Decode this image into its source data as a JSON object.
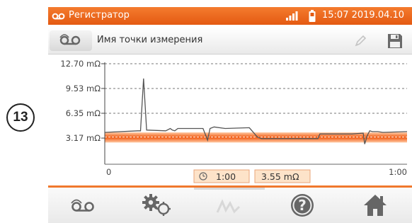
{
  "callout": {
    "number": "13"
  },
  "status_bar": {
    "title": "Регистратор",
    "time": "15:07",
    "date": "2019.04.10",
    "signal_icon": "signal-bars-icon",
    "battery_icon": "battery-icon",
    "app_icon": "recorder-icon"
  },
  "name_bar": {
    "label": "Имя точки измерения",
    "icons": [
      "recorder-icon",
      "pencil-icon",
      "save-icon"
    ]
  },
  "chart_data": {
    "type": "line",
    "y_ticks": [
      "12.70 mΩ",
      "9.53 mΩ",
      "6.35 mΩ",
      "3.17 mΩ"
    ],
    "y_tick_values": [
      12.7,
      9.53,
      6.35,
      3.17
    ],
    "ylim": [
      0,
      12.7
    ],
    "x_ticks": [
      "0",
      "1:00"
    ],
    "xlim": [
      0,
      60
    ],
    "grid": "dashed horizontal",
    "band": {
      "center": 3.3,
      "low": 2.6,
      "high": 3.9,
      "color": "#f47b2e"
    },
    "series": [
      {
        "color": "#555555",
        "x": [
          0,
          6.5,
          7.1,
          7.7,
          8.3,
          12.1,
          13.0,
          13.4,
          13.9,
          14.5,
          19.5,
          20.4,
          20.9,
          21.7,
          23.9,
          28.7,
          30.3,
          31.1,
          37.6,
          42.3,
          42.7,
          47.3,
          49.1,
          51.3,
          51.6,
          52.1,
          52.6,
          53.1,
          54.2,
          55.2,
          60
        ],
        "y": [
          3.9,
          4.1,
          4.1,
          10.8,
          4.2,
          4.1,
          4.4,
          4.2,
          4.1,
          4.4,
          4.4,
          2.9,
          4.4,
          4.6,
          4.4,
          4.5,
          3.3,
          3.1,
          3.1,
          3.1,
          3.7,
          3.7,
          3.7,
          3.8,
          2.4,
          3.5,
          4.1,
          4.0,
          4.0,
          3.9,
          4.0
        ]
      }
    ],
    "cursor": {
      "time": "1:00",
      "value": "3.55 mΩ"
    }
  },
  "toolbar": {
    "buttons": [
      {
        "icon": "recorder-icon",
        "enabled": true
      },
      {
        "icon": "settings-gears-icon",
        "enabled": true
      },
      {
        "icon": "waveform-icon",
        "enabled": false
      },
      {
        "icon": "help-icon",
        "enabled": true
      },
      {
        "icon": "home-icon",
        "enabled": true
      }
    ]
  },
  "colors": {
    "accent": "#f47b2e",
    "band": "#f47b2e",
    "trace": "#555555",
    "grid": "#777777"
  }
}
